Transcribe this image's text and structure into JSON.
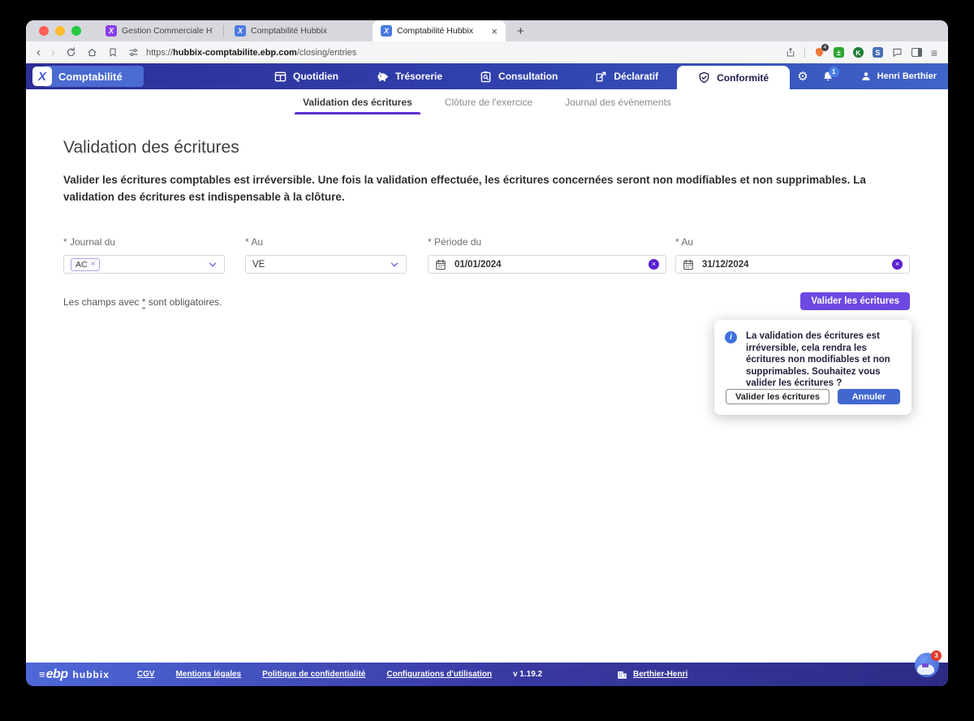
{
  "colors": {
    "accent_purple": "#6d48e3",
    "header_blue_dark": "#2e2e97",
    "header_blue_light": "#4064c9",
    "footer_blue_left": "#4e68d8",
    "footer_blue_right": "#2c2c86",
    "cancel_blue": "#4268d0",
    "info_blue": "#3f70dd",
    "notification_blue": "#4a7ce8",
    "badge_red": "#e0392c",
    "subnav_underline_purple": "#5e2ed6",
    "clear_button_purple": "#5b1fd1"
  },
  "icons": {
    "back": "‹",
    "forward": "›",
    "close": "×",
    "new_tab": "+",
    "menu": "≡",
    "gear": "⚙",
    "plus_minus": "±",
    "favicon_letter": "X",
    "k_letter": "K",
    "s_letter": "S",
    "info_letter": "i"
  },
  "browser": {
    "tabs": [
      {
        "title": "Gestion Commerciale Hubbix"
      },
      {
        "title": "Comptabilité Hubbix"
      },
      {
        "title": "Comptabilité Hubbix"
      }
    ],
    "url_scheme": "https://",
    "url_domain": "hubbix-comptabilite.ebp.com",
    "url_path": "/closing/entries",
    "shield_badge": "4"
  },
  "app_header": {
    "logo_letter": "X",
    "product": "Comptabilité",
    "nav": [
      {
        "label": "Quotidien"
      },
      {
        "label": "Trésorerie"
      },
      {
        "label": "Consultation"
      },
      {
        "label": "Déclaratif"
      },
      {
        "label": "Conformité"
      }
    ],
    "notification_count": "1",
    "user": "Henri Berthier"
  },
  "subnav": {
    "tabs": [
      {
        "label": "Validation des écritures"
      },
      {
        "label": "Clôture de l'exercice"
      },
      {
        "label": "Journal des événements"
      }
    ]
  },
  "main": {
    "title": "Validation des écritures",
    "description": "Valider les écritures comptables est irréversible. Une fois la validation effectuée, les écritures concernées seront non modifiables et non supprimables. La validation des écritures est indispensable à la clôture.",
    "form": {
      "journal_du_label": "* Journal du",
      "journal_du_chip": "AC",
      "journal_au_label": "* Au",
      "journal_au_value": "VE",
      "periode_du_label": "* Période du",
      "periode_du_value": "01/01/2024",
      "periode_au_label": "* Au",
      "periode_au_value": "31/12/2024"
    },
    "required_note_prefix": "Les champs avec ",
    "required_note_star": "*",
    "required_note_suffix": " sont obligatoires.",
    "validate_button": "Valider les écritures"
  },
  "popup": {
    "message": "La validation des écritures est irréversible, cela rendra les écritures non modifiables et non supprimables. Souhaitez vous valider les écritures ?",
    "confirm_label": "Valider les écritures",
    "cancel_label": "Annuler"
  },
  "footer": {
    "logo_mark": "≡",
    "logo_ebp": "ebp",
    "logo_hubbix": "hubbix",
    "links": [
      "CGV",
      "Mentions légales",
      "Politique de confidentialité",
      "Configurations d'utilisation"
    ],
    "version": "v 1.19.2",
    "company": "Berthier-Henri",
    "chat_badge": "3"
  }
}
